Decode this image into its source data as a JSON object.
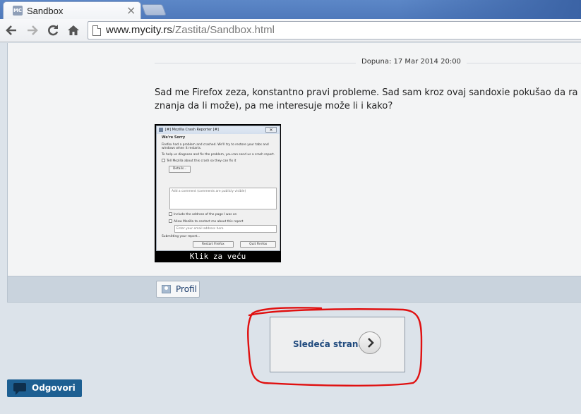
{
  "browser": {
    "tab_title": "Sandbox",
    "favicon_text": "MC",
    "close_glyph": "×",
    "url_host": "www.mycity.rs",
    "url_path": "/Zastita/Sandbox.html",
    "nav_icons": [
      "back-arrow-icon",
      "forward-arrow-icon",
      "reload-icon",
      "home-icon",
      "page-icon"
    ]
  },
  "post": {
    "date": "Dopuna: 17 Mar 2014 20:00",
    "body_line1": "Sad me Firefox zeza, konstantno pravi probleme. Sad sam kroz ovaj sandoxie pokušao da ra",
    "body_line2": "znanja da li može), pa me interesuje može li i kako?",
    "image_caption": "Klik za veću",
    "screenshot": {
      "title": "[#] Mozilla Crash Reporter [#]",
      "heading": "We're Sorry",
      "line1": "Firefox had a problem and crashed. We'll try to restore your tabs and",
      "line2": "windows when it restarts.",
      "line3": "To help us diagnose and fix the problem, you can send us a crash report.",
      "tell_mozilla": "Tell Mozilla about this crash so they can fix it",
      "details_button": "Details...",
      "comment_placeholder": "Add a comment (comments are publicly visible)",
      "include_address": "Include the address of the page I was on",
      "allow_contact": "Allow Mozilla to contact me about this report",
      "email_placeholder": "Enter your email address here",
      "submitting": "Submitting your report...",
      "restart_button": "Restart Firefox",
      "quit_button": "Quit Firefox"
    },
    "profile_label": "Profil"
  },
  "pagination": {
    "next_label": "Sledeća strana"
  },
  "reply": {
    "label": "Odgovori"
  },
  "colors": {
    "accent": "#1d5f92",
    "annotation": "#e01010",
    "page_bg": "#dce3ea"
  }
}
